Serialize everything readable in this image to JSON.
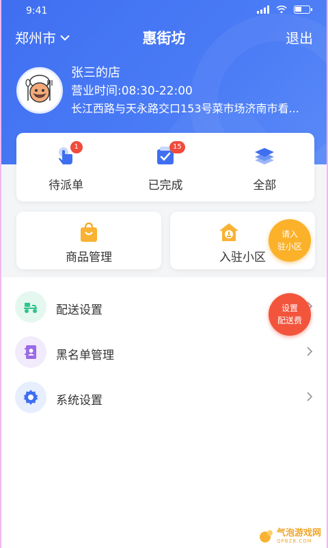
{
  "status_bar": {
    "time": "9:41",
    "battery_level": 0.45
  },
  "nav": {
    "city": "郑州市",
    "title": "惠街坊",
    "logout": "退出"
  },
  "store": {
    "name": "张三的店",
    "hours": "营业时间:08:30-22:00",
    "address": "长江西路与天永路交口153号菜市场济南市看..."
  },
  "orders": {
    "pending": {
      "label": "待派单",
      "badge": "1"
    },
    "completed": {
      "label": "已完成",
      "badge": "15"
    },
    "all": {
      "label": "全部"
    }
  },
  "tiles": {
    "products": {
      "label": "商品管理"
    },
    "community": {
      "label": "入驻小区"
    }
  },
  "bubbles": {
    "join": {
      "line1": "请入",
      "line2": "驻小区"
    },
    "fee": {
      "line1": "设置",
      "line2": "配送费"
    }
  },
  "menu": [
    {
      "label": "配送设置",
      "icon": "scooter-icon",
      "color": "#2fc48c"
    },
    {
      "label": "黑名单管理",
      "icon": "contact-book-icon",
      "color": "#9a6ae8"
    },
    {
      "label": "系统设置",
      "icon": "gear-icon",
      "color": "#3f6ff0"
    }
  ],
  "watermark": {
    "text": "气泡游戏网",
    "sub": "QPBZB.COM"
  },
  "colors": {
    "primary": "#3f6ff0",
    "badge": "#f04b3c",
    "join_bubble": "#fbb12a",
    "fee_bubble": "#f2543c"
  }
}
